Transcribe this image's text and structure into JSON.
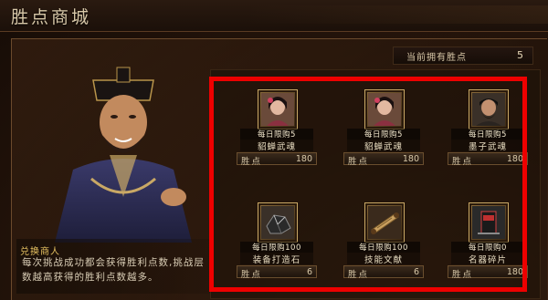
{
  "header": {
    "title": "胜点商城"
  },
  "points": {
    "label": "当前拥有胜点",
    "value": "5"
  },
  "dialog": {
    "speaker": "兑换商人",
    "text": "每次挑战成功都会获得胜利点数,挑战层数越高获得的胜利点数越多。"
  },
  "shop": {
    "price_label": "胜点",
    "items": [
      {
        "limit": "每日限购5",
        "name": "貂蝉武魂",
        "price": "180",
        "icon": "diaochan-portrait-icon"
      },
      {
        "limit": "每日限购5",
        "name": "貂蝉武魂",
        "price": "180",
        "icon": "diaochan-portrait-icon"
      },
      {
        "limit": "每日限购5",
        "name": "墨子武魂",
        "price": "180",
        "icon": "mozi-portrait-icon"
      },
      {
        "limit": "每日限购100",
        "name": "装备打造石",
        "price": "6",
        "icon": "forging-stone-icon"
      },
      {
        "limit": "每日限购100",
        "name": "技能文献",
        "price": "6",
        "icon": "scroll-icon"
      },
      {
        "limit": "每日限购0",
        "name": "名器碎片",
        "price": "180",
        "icon": "artifact-shard-icon"
      }
    ]
  },
  "colors": {
    "highlight": "#ee0000",
    "accent_gold": "#c9a865"
  }
}
